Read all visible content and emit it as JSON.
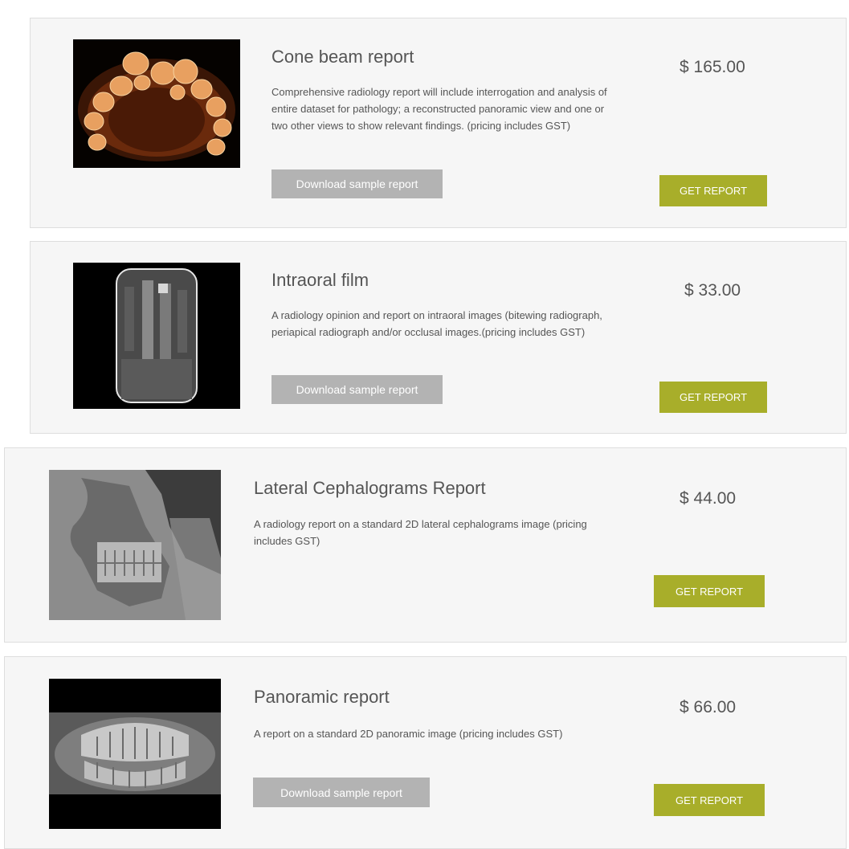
{
  "products": [
    {
      "title": "Cone beam report",
      "description": "Comprehensive radiology report will include interrogation and analysis of entire dataset for pathology; a reconstructed panoramic view and one or two other views to show relevant findings. (pricing includes GST)",
      "download_label": "Download sample report",
      "price": "$ 165.00",
      "cta_label": "GET REPORT"
    },
    {
      "title": "Intraoral film",
      "description": "A radiology opinion and report on intraoral images (bitewing radiograph, periapical radiograph and/or occlusal images.(pricing includes GST)",
      "download_label": "Download sample report",
      "price": "$ 33.00",
      "cta_label": "GET REPORT"
    },
    {
      "title": "Lateral Cephalograms Report",
      "description": "A radiology report on a standard 2D lateral cephalograms image (pricing includes GST)",
      "price": "$ 44.00",
      "cta_label": "GET REPORT"
    },
    {
      "title": "Panoramic report",
      "description": "A report on a standard 2D panoramic image (pricing includes GST)",
      "download_label": "Download sample report",
      "price": "$ 66.00",
      "cta_label": "GET REPORT"
    }
  ],
  "colors": {
    "card_bg": "#f6f6f6",
    "accent": "#a8ae2a",
    "secondary_button": "#b3b3b3"
  }
}
